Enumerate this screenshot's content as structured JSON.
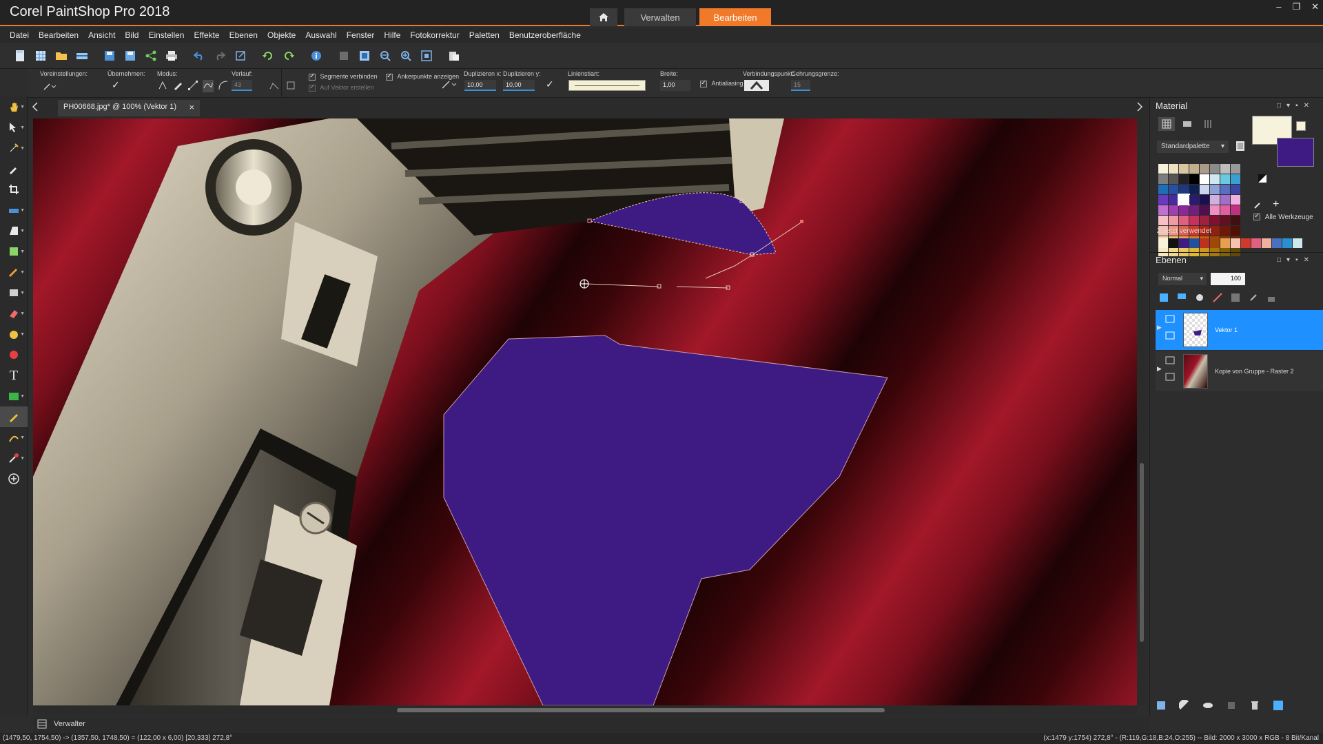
{
  "app": {
    "title": "Corel PaintShop Pro 2018",
    "workspaces": [
      "Verwalten",
      "Bearbeiten"
    ],
    "active_workspace": "Bearbeiten",
    "window_controls": [
      "–",
      "❐",
      "✕"
    ]
  },
  "menu": [
    "Datei",
    "Bearbeiten",
    "Ansicht",
    "Bild",
    "Einstellen",
    "Effekte",
    "Ebenen",
    "Objekte",
    "Auswahl",
    "Fenster",
    "Hilfe",
    "Fotokorrektur",
    "Paletten",
    "Benutzeroberfläche"
  ],
  "options": {
    "presets_label": "Voreinstellungen:",
    "apply_label": "Übernehmen:",
    "mode_label": "Modus:",
    "gradient_label": "Verlauf:",
    "gradient_value": "43",
    "connect_segments": "Segmente verbinden",
    "on_vector": "Auf Vektor erstellen",
    "show_anchors": "Ankerpunkte anzeigen",
    "dup_x_label": "Duplizieren x:",
    "dup_x_value": "10,00",
    "dup_y_label": "Duplizieren y:",
    "dup_y_value": "10,00",
    "linestyle_label": "Linienstiart:",
    "width_label": "Breite:",
    "width_value": "1,00",
    "antialiasing": "Antialiasing",
    "join_label": "Verbindungspunkt:",
    "miter_label": "Gehrungsgrenze:",
    "miter_value": "15"
  },
  "document": {
    "tab_label": "PH00668.jpg* @ 100% (Vektor 1)",
    "close_glyph": "×"
  },
  "material": {
    "title": "Material",
    "palette_select": "Standardpalette",
    "all_tools": "Alle Werkzeuge",
    "recent_label": "Zuletzt verwendet",
    "foreground": "#f6f2dc",
    "background": "#3d1b83"
  },
  "layers": {
    "title": "Ebenen",
    "blend_mode": "Normal",
    "opacity": "100",
    "items": [
      {
        "name": "Vektor 1",
        "selected": true
      },
      {
        "name": "Kopie von Gruppe - Raster 2",
        "selected": false
      }
    ]
  },
  "organizer": {
    "label": "Verwalter"
  },
  "status": {
    "left": "(1479,50, 1754,50) -> (1357,50, 1748,50) = (122,00 x 6,00) [20,333]  272,8°",
    "right": "(x:1479 y:1754) 272,8° - (R:119,G:18,B:24,O:255) -- Bild: 2000 x 3000 x RGB - 8 Bit/Kanal"
  },
  "colors": {
    "accent": "#f07a2a",
    "selection": "#1e90ff",
    "shape_fill": "#3d1b83"
  }
}
